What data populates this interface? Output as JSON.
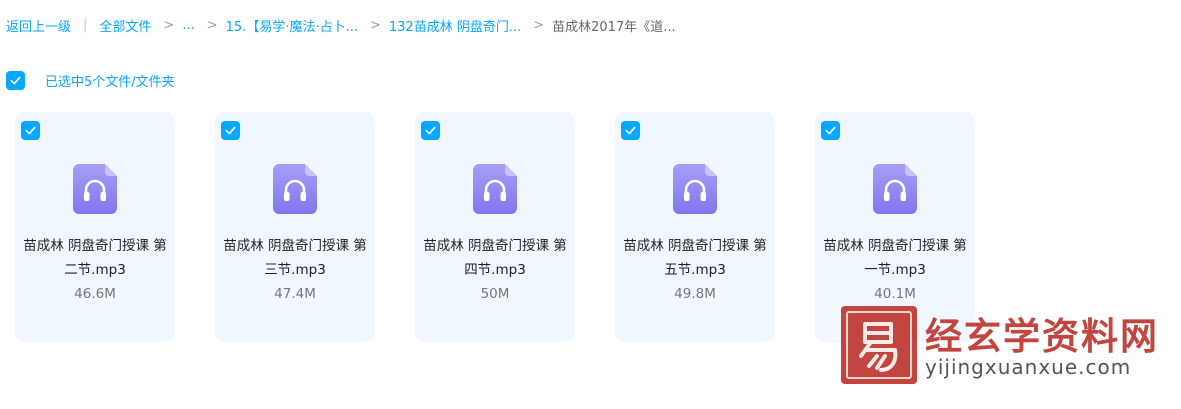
{
  "breadcrumb": {
    "back": "返回上一级",
    "divider": "|",
    "root": "全部文件",
    "separator": ">",
    "items": [
      "...",
      "15.【易学·魔法·占卜...",
      "132苗成林 阴盘奇门..."
    ],
    "current": "苗成林2017年《道..."
  },
  "selection": {
    "text": "已选中5个文件/文件夹",
    "checked": true
  },
  "files": [
    {
      "name": "苗成林 阴盘奇门授课 第二节.mp3",
      "size": "46.6M",
      "checked": true,
      "icon": "audio-file-icon"
    },
    {
      "name": "苗成林 阴盘奇门授课 第三节.mp3",
      "size": "47.4M",
      "checked": true,
      "icon": "audio-file-icon"
    },
    {
      "name": "苗成林 阴盘奇门授课 第四节.mp3",
      "size": "50M",
      "checked": true,
      "icon": "audio-file-icon"
    },
    {
      "name": "苗成林 阴盘奇门授课 第五节.mp3",
      "size": "49.8M",
      "checked": true,
      "icon": "audio-file-icon"
    },
    {
      "name": "苗成林 阴盘奇门授课 第一节.mp3",
      "size": "40.1M",
      "checked": true,
      "icon": "audio-file-icon"
    }
  ],
  "watermark": {
    "title": "经玄学资料网",
    "url": "yijingxuanxue.com"
  },
  "colors": {
    "accent": "#06a7ff",
    "card_bg": "#f0f7fe",
    "icon_purple": "#8b83f0",
    "watermark_red": "#c2453f"
  }
}
